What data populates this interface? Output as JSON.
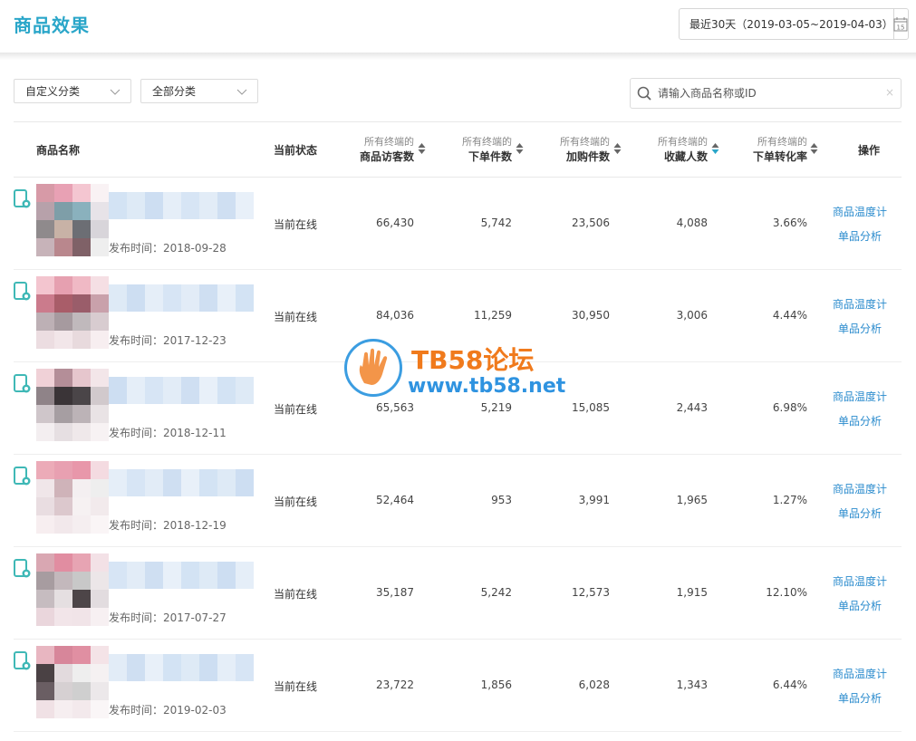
{
  "header": {
    "title": "商品效果",
    "date_range": "最近30天（2019-03-05~2019-04-03）",
    "calendar_day": "15"
  },
  "filters": {
    "custom_category": "自定义分类",
    "all_category": "全部分类",
    "search_placeholder": "请输入商品名称或ID",
    "clear": "×"
  },
  "table": {
    "headers": {
      "name": "商品名称",
      "status": "当前状态",
      "visitors_l1": "所有终端的",
      "visitors_l2": "商品访客数",
      "orders_l1": "所有终端的",
      "orders_l2": "下单件数",
      "cart_l1": "所有终端的",
      "cart_l2": "加购件数",
      "fav_l1": "所有终端的",
      "fav_l2": "收藏人数",
      "conv_l1": "所有终端的",
      "conv_l2": "下单转化率",
      "ops": "操作"
    },
    "active_sort_color": "#2aa6c9",
    "rows": [
      {
        "publish": "发布时间：2018-09-28",
        "status": "当前在线",
        "visitors": "66,430",
        "orders": "5,742",
        "cart": "23,506",
        "fav": "4,088",
        "conv": "3.66%",
        "op1": "商品温度计",
        "op2": "单品分析"
      },
      {
        "publish": "发布时间：2017-12-23",
        "status": "当前在线",
        "visitors": "84,036",
        "orders": "11,259",
        "cart": "30,950",
        "fav": "3,006",
        "conv": "4.44%",
        "op1": "商品温度计",
        "op2": "单品分析"
      },
      {
        "publish": "发布时间：2018-12-11",
        "status": "当前在线",
        "visitors": "65,563",
        "orders": "5,219",
        "cart": "15,085",
        "fav": "2,443",
        "conv": "6.98%",
        "op1": "商品温度计",
        "op2": "单品分析"
      },
      {
        "publish": "发布时间：2018-12-19",
        "status": "当前在线",
        "visitors": "52,464",
        "orders": "953",
        "cart": "3,991",
        "fav": "1,965",
        "conv": "1.27%",
        "op1": "商品温度计",
        "op2": "单品分析"
      },
      {
        "publish": "发布时间：2017-07-27",
        "status": "当前在线",
        "visitors": "35,187",
        "orders": "5,242",
        "cart": "12,573",
        "fav": "1,915",
        "conv": "12.10%",
        "op1": "商品温度计",
        "op2": "单品分析"
      },
      {
        "publish": "发布时间：2019-02-03",
        "status": "当前在线",
        "visitors": "23,722",
        "orders": "1,856",
        "cart": "6,028",
        "fav": "1,343",
        "conv": "6.44%",
        "op1": "商品温度计",
        "op2": "单品分析"
      }
    ]
  },
  "watermark": {
    "title": "TB58论坛",
    "url": "www.tb58.net"
  }
}
